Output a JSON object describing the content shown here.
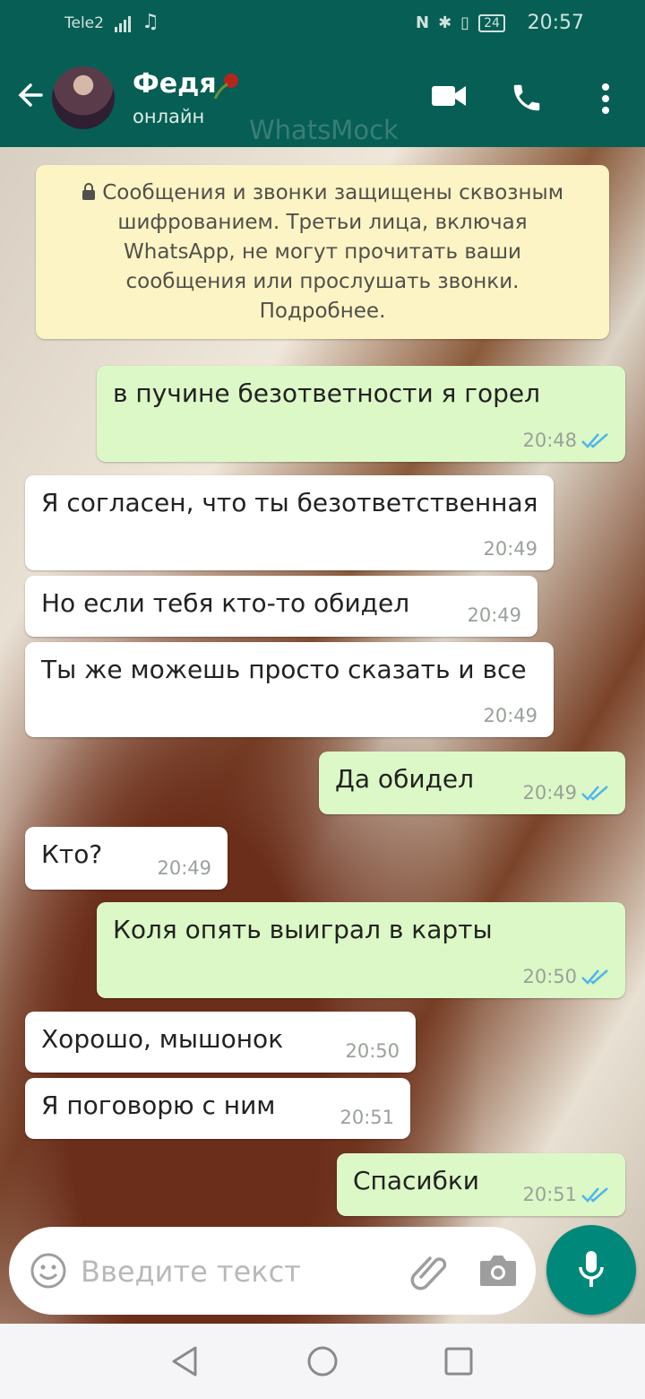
{
  "status_bar": {
    "carrier": "Tele2",
    "battery": "24",
    "time": "20:57"
  },
  "header": {
    "name": "Федя",
    "status": "онлайн",
    "watermark": "WhatsMock"
  },
  "encryption_notice": "Сообщения и звонки защищены сквозным шифрованием. Третьи лица, включая WhatsApp, не могут прочитать ваши сообщения или прослушать звонки. Подробнее.",
  "messages": [
    {
      "text": "в пучине безответности я горел",
      "time": "20:48",
      "direction": "out"
    },
    {
      "text": "Я согласен, что ты безответственная",
      "time": "20:49",
      "direction": "in"
    },
    {
      "text": "Но если тебя кто-то обидел",
      "time": "20:49",
      "direction": "in"
    },
    {
      "text": "Ты же можешь просто сказать и все",
      "time": "20:49",
      "direction": "in"
    },
    {
      "text": "Да обидел",
      "time": "20:49",
      "direction": "out"
    },
    {
      "text": "Кто?",
      "time": "20:49",
      "direction": "in"
    },
    {
      "text": "Коля опять выиграл в карты",
      "time": "20:50",
      "direction": "out"
    },
    {
      "text": "Хорошо, мышонок",
      "time": "20:50",
      "direction": "in"
    },
    {
      "text": "Я поговорю с ним",
      "time": "20:51",
      "direction": "in"
    },
    {
      "text": "Спасибки",
      "time": "20:51",
      "direction": "out"
    }
  ],
  "composer": {
    "placeholder": "Введите текст"
  },
  "colors": {
    "header": "#075e54",
    "outgoing_bubble": "#dcf8c6",
    "incoming_bubble": "#ffffff",
    "read_ticks": "#4fb6ec",
    "mic_button": "#00897b"
  },
  "icons": [
    "back-arrow-icon",
    "video-call-icon",
    "phone-icon",
    "more-vert-icon",
    "lock-icon",
    "emoji-icon",
    "attach-icon",
    "camera-icon",
    "mic-icon",
    "nav-back-icon",
    "nav-home-icon",
    "nav-recents-icon"
  ]
}
